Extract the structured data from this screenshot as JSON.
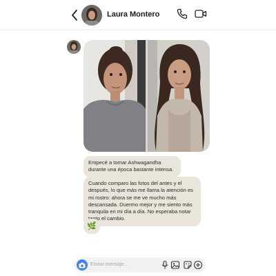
{
  "header": {
    "contact_name": "Laura Montero",
    "icons": [
      "back-chevron-icon",
      "phone-icon",
      "video-camera-icon"
    ]
  },
  "conversation": {
    "photo_message": {
      "description_panels": [
        "antes",
        "después"
      ]
    },
    "messages": [
      {
        "text": "Empecé a tomar Ashwagandha durante una época bastante intensa."
      },
      {
        "text": "Cuando comparo las fotos del antes y el después, lo que más me llama la atención es mi rostro: ahora se me ve mucho más descansada. Duermo mejor y me siento más tranquila en mi día a día. No esperaba notar tanto el cambio."
      },
      {
        "emoji": "🌿"
      }
    ]
  },
  "composer": {
    "placeholder": "Enviar mensaje..."
  },
  "colors": {
    "bubble": "#e9e5da",
    "camera_button": "#3f7ff2",
    "composer_bg": "#f1f1f1"
  }
}
